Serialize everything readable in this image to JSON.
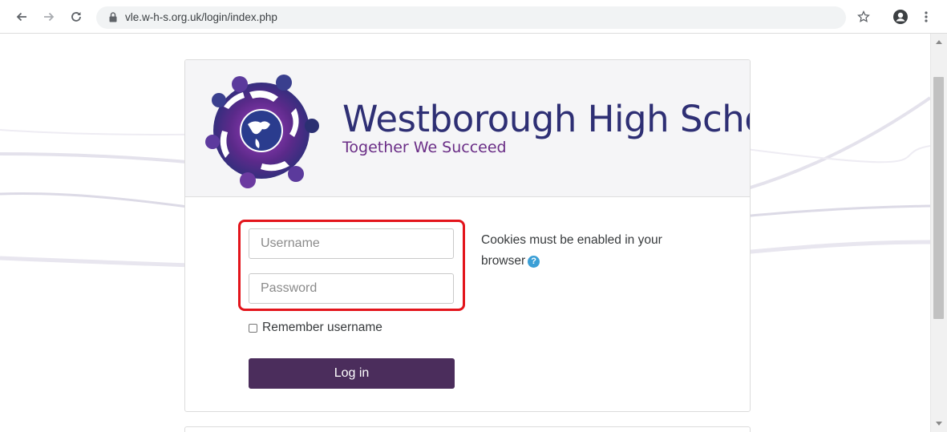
{
  "browser": {
    "url": "vle.w-h-s.org.uk/login/index.php",
    "icons": {
      "back": "back-arrow-icon",
      "forward": "forward-arrow-icon",
      "reload": "reload-icon",
      "lock": "lock-icon",
      "bookmark": "star-icon",
      "profile": "account-icon",
      "menu": "kebab-menu-icon"
    }
  },
  "header": {
    "school_name": "Westborough High School",
    "tagline": "Together We Succeed"
  },
  "login": {
    "username_placeholder": "Username",
    "password_placeholder": "Password",
    "remember_label": "Remember username",
    "remember_checked": false,
    "login_button": "Log in",
    "cookies_notice": "Cookies must be enabled in your browser"
  },
  "colors": {
    "brand_navy": "#2e2f74",
    "brand_purple": "#6a2d86",
    "button": "#4b2d5c",
    "highlight": "#e3141b",
    "help_icon": "#3b9fd6"
  }
}
